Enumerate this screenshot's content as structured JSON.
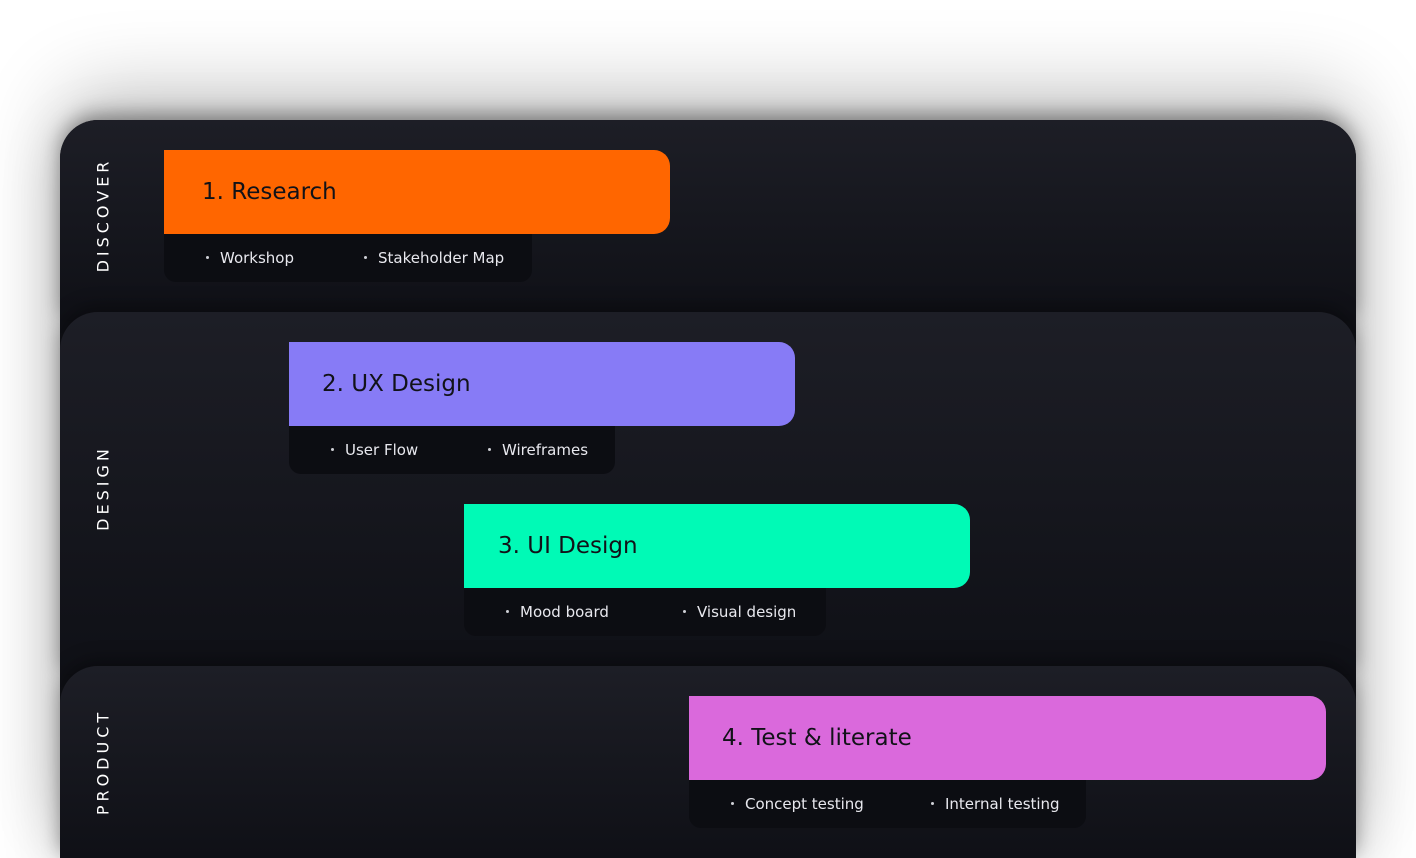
{
  "lanes": {
    "discover": "DISCOVER",
    "design": "DESIGN",
    "product": "PRODUCT"
  },
  "steps": [
    {
      "title": "1. Research",
      "color": "#ff6600",
      "items": [
        "Workshop",
        "Stakeholder Map"
      ]
    },
    {
      "title": "2. UX Design",
      "color": "#877bf6",
      "items": [
        "User Flow",
        "Wireframes"
      ]
    },
    {
      "title": "3. UI Design",
      "color": "#00fab6",
      "items": [
        "Mood board",
        "Visual design"
      ]
    },
    {
      "title": "4. Test & literate",
      "color": "#da69dc",
      "items": [
        "Concept testing",
        "Internal testing"
      ]
    }
  ]
}
